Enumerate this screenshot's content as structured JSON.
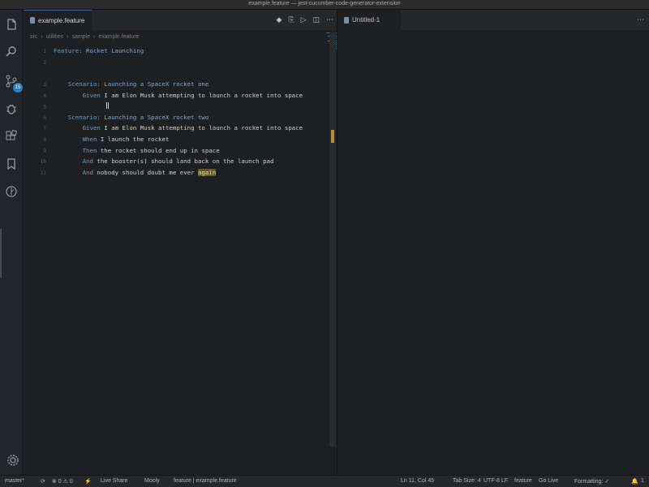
{
  "window": {
    "title": "example.feature — jest-cucumber-code-generator-extension"
  },
  "activity_bar": {
    "items": [
      {
        "name": "explorer",
        "icon": "files-icon"
      },
      {
        "name": "search",
        "icon": "search-icon"
      },
      {
        "name": "source-control",
        "icon": "source-control-icon",
        "badge": "15"
      },
      {
        "name": "debug",
        "icon": "bug-icon"
      },
      {
        "name": "extensions",
        "icon": "extensions-icon"
      },
      {
        "name": "bookmarks",
        "icon": "bookmark-icon"
      },
      {
        "name": "git-graph",
        "icon": "git-icon"
      }
    ],
    "manage_icon": "gear-icon"
  },
  "editor_left": {
    "tab": {
      "label": "example.feature",
      "close": "×"
    },
    "actions": [
      "◆",
      "⎘",
      "▷",
      "◫",
      "⋯"
    ],
    "breadcrumb": [
      "src",
      "utilities",
      "sample",
      "example.feature"
    ],
    "lines": [
      {
        "num": "1",
        "parts": [
          {
            "t": "Feature: ",
            "c": "kw"
          },
          {
            "t": "Rocket Launching",
            "c": "kw2"
          }
        ]
      },
      {
        "num": "2",
        "parts": []
      },
      {
        "num": "3",
        "parts": [
          {
            "t": "    Scenario: ",
            "c": "kw"
          },
          {
            "t": "Launching a SpaceX rocket one",
            "c": "kw2"
          }
        ]
      },
      {
        "num": "4",
        "parts": [
          {
            "t": "        Given ",
            "c": "kw"
          },
          {
            "t": "I am Elon Musk attempting to launch a rocket into space",
            "c": "plain"
          }
        ]
      },
      {
        "num": "5",
        "parts": []
      },
      {
        "num": "6",
        "parts": [
          {
            "t": "    Scenario: ",
            "c": "kw"
          },
          {
            "t": "Launching a SpaceX rocket two",
            "c": "kw2"
          }
        ]
      },
      {
        "num": "7",
        "parts": [
          {
            "t": "        Given ",
            "c": "kw"
          },
          {
            "t": "I am Elon Musk attempting to launch a rocket into space",
            "c": "plain"
          }
        ]
      },
      {
        "num": "8",
        "parts": [
          {
            "t": "        When ",
            "c": "kw"
          },
          {
            "t": "I launch the rocket",
            "c": "plain"
          }
        ]
      },
      {
        "num": "9",
        "parts": [
          {
            "t": "        Then ",
            "c": "kw"
          },
          {
            "t": "the rocket should end up in space",
            "c": "plain"
          }
        ]
      },
      {
        "num": "10",
        "parts": [
          {
            "t": "        And ",
            "c": "kw"
          },
          {
            "t": "the booster(s) should land back on the launch pad",
            "c": "plain"
          }
        ]
      },
      {
        "num": "11",
        "parts": [
          {
            "t": "        And ",
            "c": "kw"
          },
          {
            "t": "nobody should doubt me ever ",
            "c": "plain"
          },
          {
            "t": "again",
            "c": "hl"
          }
        ]
      }
    ]
  },
  "editor_right": {
    "tab": {
      "label": "Untitled-1"
    },
    "more": "⋯"
  },
  "status_bar": {
    "branch": "master*",
    "sync": "⟳",
    "problems": "⊗ 0  ⚠ 0",
    "lightning": "⚡",
    "live_share": "Live Share",
    "mooly": "Mooly",
    "path": "feature | example.feature",
    "position": "Ln 11, Col 45",
    "tab_size": "Tab Size: 4",
    "encoding": "UTF-8",
    "eol": "LF",
    "language": "feature",
    "go_live": "Go Live",
    "formatting": "Formatting: ✓",
    "notifications": "1"
  }
}
